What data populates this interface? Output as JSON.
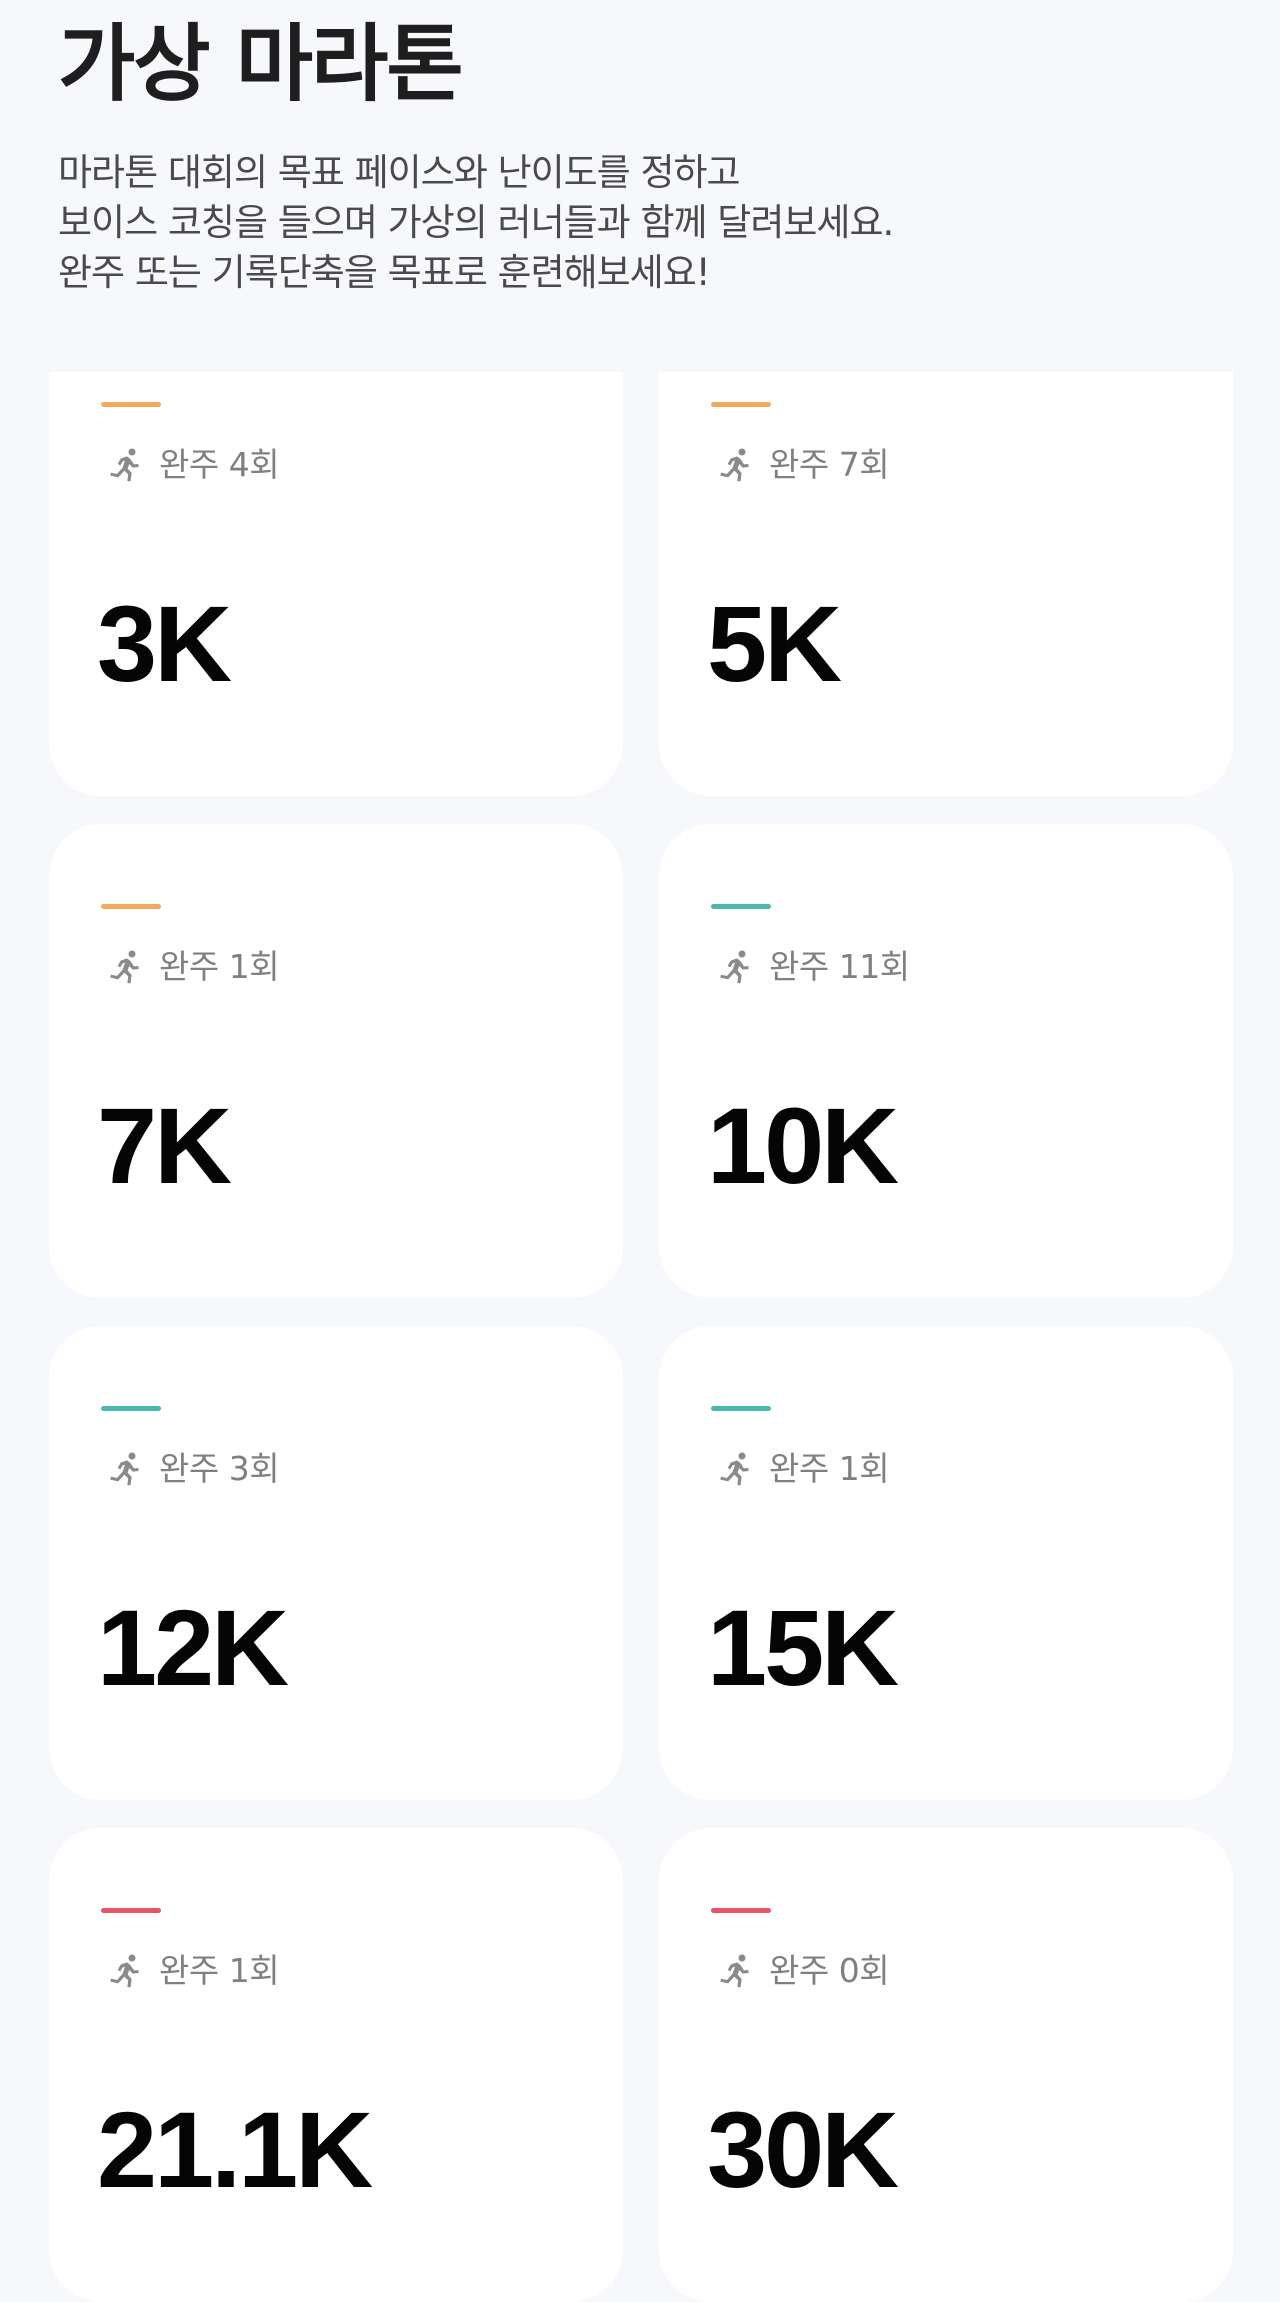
{
  "header": {
    "title": "가상 마라톤",
    "description_lines": [
      "마라톤 대회의 목표 페이스와 난이도를 정하고",
      "보이스 코칭을 들으며 가상의 러너들과 함께 달려보세요.",
      "완주 또는 기록단축을 목표로 훈련해보세요!"
    ]
  },
  "colors": {
    "background": "#f7f8fc",
    "card": "#ffffff",
    "accent_orange": "#f4a85e",
    "accent_teal": "#4bb8ae",
    "accent_red": "#e85468",
    "icon_gray": "#8a8a8a"
  },
  "icons": {
    "runner": "runner-icon"
  },
  "races": [
    {
      "distance": "3K",
      "count_label": "완주 4회",
      "accent": "orange"
    },
    {
      "distance": "5K",
      "count_label": "완주 7회",
      "accent": "orange"
    },
    {
      "distance": "7K",
      "count_label": "완주 1회",
      "accent": "orange"
    },
    {
      "distance": "10K",
      "count_label": "완주 11회",
      "accent": "teal"
    },
    {
      "distance": "12K",
      "count_label": "완주 3회",
      "accent": "teal"
    },
    {
      "distance": "15K",
      "count_label": "완주 1회",
      "accent": "teal"
    },
    {
      "distance": "21.1K",
      "count_label": "완주 1회",
      "accent": "red"
    },
    {
      "distance": "30K",
      "count_label": "완주 0회",
      "accent": "red"
    }
  ]
}
